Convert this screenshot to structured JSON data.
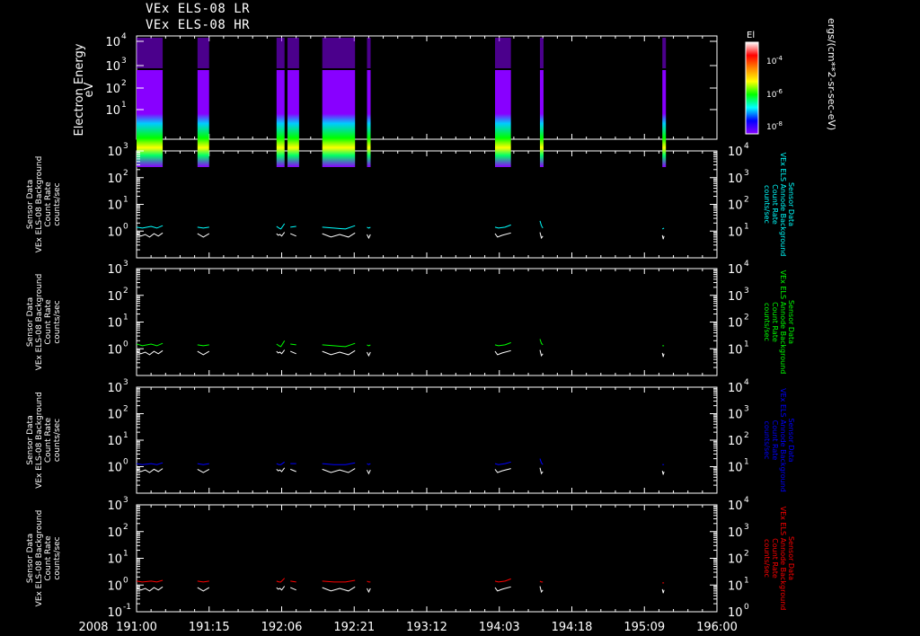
{
  "header": {
    "titles": [
      "VEx ELS-08 LR",
      "VEx ELS-08 HR"
    ]
  },
  "chart_data": [
    {
      "type": "heatmap",
      "ylabel": [
        "Electron Energy",
        "eV"
      ],
      "y_scale": "log",
      "y_ticks": [
        "10",
        "10",
        "10",
        "10"
      ],
      "y_tick_exponents": [
        "4",
        "3",
        "2",
        "1"
      ],
      "ylim": [
        1,
        20000
      ],
      "colorbar": {
        "label": "El",
        "ticks": [
          "10",
          "10",
          "10"
        ],
        "exponents": [
          "-4",
          "-6",
          "-8"
        ],
        "units": "ergs/(cm**2-sr-sec-eV)",
        "colors": [
          "#ffffff",
          "#ff0000",
          "#ff8800",
          "#ffff00",
          "#00ff00",
          "#00ffff",
          "#0000ff",
          "#8800ff"
        ]
      },
      "data_intervals": [
        [
          191.0,
          191.09
        ],
        [
          191.21,
          191.25
        ],
        [
          192.04,
          192.11
        ],
        [
          192.12,
          192.16
        ],
        [
          192.24,
          192.36
        ],
        [
          192.5,
          192.54
        ],
        [
          194.0,
          194.09
        ],
        [
          194.19,
          194.2
        ],
        [
          195.36,
          195.38
        ]
      ]
    },
    {
      "type": "line",
      "ylabel": [
        "Sensor Data",
        "VEx ELS-08 Background",
        "Count Rate",
        "counts/sec"
      ],
      "right_label": [
        "Sensor Data",
        "VEx ELS Annode Background",
        "Count Rate",
        "counts/sec"
      ],
      "color": "#00ffff",
      "y_scale": "log",
      "ylim": [
        0.1,
        1000
      ],
      "right_ylim": [
        1,
        10000
      ],
      "series": [
        {
          "x": [
            191.0,
            191.02,
            191.05,
            191.07,
            191.09
          ],
          "y": [
            1.4,
            1.3,
            1.5,
            1.3,
            1.6
          ]
        },
        {
          "x": [
            191.21,
            191.23,
            191.25
          ],
          "y": [
            1.4,
            1.3,
            1.4
          ]
        },
        {
          "x": [
            192.04,
            192.07,
            192.09,
            192.11
          ],
          "y": [
            1.5,
            1.3,
            1.2,
            1.9
          ]
        },
        {
          "x": [
            192.13,
            192.15
          ],
          "y": [
            1.4,
            1.5
          ]
        },
        {
          "x": [
            192.24,
            192.28,
            192.32,
            192.36
          ],
          "y": [
            1.4,
            1.3,
            1.2,
            1.6
          ]
        },
        {
          "x": [
            192.5,
            192.52,
            192.54
          ],
          "y": [
            1.4,
            1.3,
            1.4
          ]
        },
        {
          "x": [
            194.0,
            194.04,
            194.07,
            194.09
          ],
          "y": [
            1.4,
            1.3,
            1.4,
            1.7
          ]
        },
        {
          "x": [
            194.19,
            194.195,
            194.2
          ],
          "y": [
            2.4,
            1.6,
            1.3
          ]
        },
        {
          "x": [
            195.36,
            195.38
          ],
          "y": [
            1.2,
            1.3
          ]
        }
      ]
    },
    {
      "type": "line",
      "ylabel": [
        "Sensor Data",
        "VEx ELS-08 Background",
        "Count Rate",
        "counts/sec"
      ],
      "right_label": [
        "Sensor Data",
        "VEx ELS Annode Background",
        "Count Rate",
        "counts/sec"
      ],
      "color": "#00ff00",
      "y_scale": "log",
      "ylim": [
        0.1,
        1000
      ],
      "right_ylim": [
        1,
        10000
      ],
      "series": [
        {
          "x": [
            191.0,
            191.02,
            191.05,
            191.07,
            191.09
          ],
          "y": [
            1.5,
            1.3,
            1.5,
            1.3,
            1.6
          ]
        },
        {
          "x": [
            191.21,
            191.23,
            191.25
          ],
          "y": [
            1.4,
            1.3,
            1.4
          ]
        },
        {
          "x": [
            192.04,
            192.07,
            192.09,
            192.11
          ],
          "y": [
            1.5,
            1.3,
            1.2,
            2.0
          ]
        },
        {
          "x": [
            192.13,
            192.15
          ],
          "y": [
            1.5,
            1.4
          ]
        },
        {
          "x": [
            192.24,
            192.28,
            192.32,
            192.36
          ],
          "y": [
            1.4,
            1.3,
            1.2,
            1.6
          ]
        },
        {
          "x": [
            192.5,
            192.52,
            192.54
          ],
          "y": [
            1.4,
            1.3,
            1.4
          ]
        },
        {
          "x": [
            194.0,
            194.04,
            194.07,
            194.09
          ],
          "y": [
            1.4,
            1.3,
            1.4,
            1.7
          ]
        },
        {
          "x": [
            194.19,
            194.195,
            194.2
          ],
          "y": [
            2.3,
            1.6,
            1.4
          ]
        },
        {
          "x": [
            195.36,
            195.38
          ],
          "y": [
            1.3,
            1.3
          ]
        }
      ]
    },
    {
      "type": "line",
      "ylabel": [
        "Sensor Data",
        "VEx ELS-08 Background",
        "Count Rate",
        "counts/sec"
      ],
      "right_label": [
        "Sensor Data",
        "VEx ELS Annode Background",
        "Count Rate",
        "counts/sec"
      ],
      "color": "#0000ff",
      "y_scale": "log",
      "ylim": [
        0.1,
        1000
      ],
      "right_ylim": [
        1,
        10000
      ],
      "series": [
        {
          "x": [
            191.0,
            191.02,
            191.05,
            191.07,
            191.09
          ],
          "y": [
            1.3,
            1.2,
            1.3,
            1.2,
            1.4
          ]
        },
        {
          "x": [
            191.21,
            191.23,
            191.25
          ],
          "y": [
            1.3,
            1.2,
            1.3
          ]
        },
        {
          "x": [
            192.04,
            192.07,
            192.09,
            192.11
          ],
          "y": [
            1.3,
            1.2,
            1.2,
            1.5
          ]
        },
        {
          "x": [
            192.13,
            192.15
          ],
          "y": [
            1.3,
            1.3
          ]
        },
        {
          "x": [
            192.24,
            192.28,
            192.32,
            192.36
          ],
          "y": [
            1.3,
            1.2,
            1.2,
            1.4
          ]
        },
        {
          "x": [
            192.5,
            192.52,
            192.54
          ],
          "y": [
            1.3,
            1.2,
            1.3
          ]
        },
        {
          "x": [
            194.0,
            194.04,
            194.07,
            194.09
          ],
          "y": [
            1.3,
            1.2,
            1.3,
            1.5
          ]
        },
        {
          "x": [
            194.19,
            194.195,
            194.2
          ],
          "y": [
            2.0,
            1.4,
            1.2
          ]
        },
        {
          "x": [
            195.36,
            195.38
          ],
          "y": [
            1.2,
            1.2
          ]
        }
      ]
    },
    {
      "type": "line",
      "ylabel": [
        "Sensor Data",
        "VEx ELS-08 Background",
        "Count Rate",
        "counts/sec"
      ],
      "right_label": [
        "Sensor Data",
        "VEx ELS Annode Background",
        "Count Rate",
        "counts/sec"
      ],
      "color": "#ff0000",
      "y_scale": "log",
      "ylim": [
        0.1,
        1000
      ],
      "right_ylim": [
        1,
        10000
      ],
      "series": [
        {
          "x": [
            191.0,
            191.02,
            191.05,
            191.07,
            191.09
          ],
          "y": [
            1.4,
            1.3,
            1.4,
            1.3,
            1.5
          ]
        },
        {
          "x": [
            191.21,
            191.23,
            191.25
          ],
          "y": [
            1.4,
            1.3,
            1.4
          ]
        },
        {
          "x": [
            192.04,
            192.07,
            192.09,
            192.11
          ],
          "y": [
            1.4,
            1.3,
            1.3,
            1.8
          ]
        },
        {
          "x": [
            192.13,
            192.15
          ],
          "y": [
            1.4,
            1.3
          ]
        },
        {
          "x": [
            192.24,
            192.28,
            192.32,
            192.36
          ],
          "y": [
            1.4,
            1.3,
            1.3,
            1.5
          ]
        },
        {
          "x": [
            192.5,
            192.52,
            192.54
          ],
          "y": [
            1.4,
            1.3,
            1.3
          ]
        },
        {
          "x": [
            194.0,
            194.04,
            194.07,
            194.09
          ],
          "y": [
            1.4,
            1.3,
            1.4,
            1.7
          ]
        },
        {
          "x": [
            194.19,
            194.195,
            194.2
          ],
          "y": [
            1.4,
            1.3,
            1.3
          ]
        },
        {
          "x": [
            195.36,
            195.38
          ],
          "y": [
            1.2,
            1.2
          ]
        }
      ]
    }
  ],
  "white_series": {
    "color": "#ffffff",
    "note_free": true,
    "series": [
      {
        "x": [
          191.0,
          191.015,
          191.03,
          191.045,
          191.06,
          191.075,
          191.09
        ],
        "y": [
          0.8,
          0.65,
          0.75,
          0.6,
          0.8,
          0.65,
          0.85
        ]
      },
      {
        "x": [
          191.21,
          191.23,
          191.25
        ],
        "y": [
          0.8,
          0.6,
          0.8
        ]
      },
      {
        "x": [
          192.04,
          192.06,
          192.08,
          192.1,
          192.11
        ],
        "y": [
          0.8,
          0.7,
          0.75,
          0.65,
          0.9
        ]
      },
      {
        "x": [
          192.13,
          192.15
        ],
        "y": [
          0.8,
          0.65
        ]
      },
      {
        "x": [
          192.24,
          192.27,
          192.3,
          192.33,
          192.36
        ],
        "y": [
          0.8,
          0.6,
          0.75,
          0.6,
          0.85
        ]
      },
      {
        "x": [
          192.5,
          192.52,
          192.54
        ],
        "y": [
          0.75,
          0.55,
          0.75
        ]
      },
      {
        "x": [
          194.0,
          194.03,
          194.06,
          194.09
        ],
        "y": [
          0.8,
          0.6,
          0.7,
          0.85
        ]
      },
      {
        "x": [
          194.19,
          194.195,
          194.2
        ],
        "y": [
          0.9,
          0.55,
          0.65
        ]
      },
      {
        "x": [
          195.36,
          195.37,
          195.38
        ],
        "y": [
          0.7,
          0.5,
          0.65
        ]
      }
    ]
  },
  "axes": {
    "year": "2008",
    "x_ticks": [
      "191:00",
      "191:15",
      "192:06",
      "192:21",
      "193:12",
      "194:03",
      "194:18",
      "195:09",
      "196:00"
    ],
    "x_tick_values": [
      191.0,
      191.25,
      192.1,
      192.35,
      193.2,
      194.05,
      194.3,
      195.15,
      196.0
    ],
    "left_y_ticks": [
      "10",
      "10",
      "10",
      "10",
      "10"
    ],
    "left_y_exponents": [
      "3",
      "2",
      "1",
      "0",
      "-1"
    ],
    "right_y_ticks": [
      "10",
      "10",
      "10",
      "10",
      "10"
    ],
    "right_y_exponents": [
      "4",
      "3",
      "2",
      "1",
      "0"
    ]
  }
}
